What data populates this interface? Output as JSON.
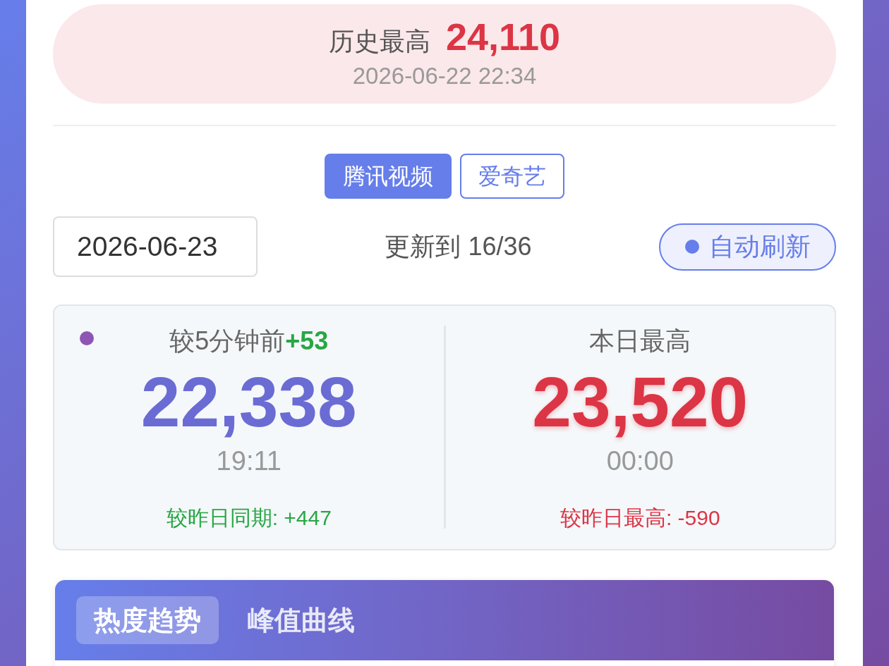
{
  "record": {
    "label": "历史最高",
    "value": "24,110",
    "time": "2026-06-22 22:34"
  },
  "platform_tabs": [
    {
      "label": "腾讯视频",
      "selected": true
    },
    {
      "label": "爱奇艺",
      "selected": false
    }
  ],
  "date_field": {
    "value": "2026-06-23"
  },
  "update_status": "更新到 16/36",
  "auto_refresh": {
    "label": "自动刷新",
    "on": true
  },
  "stats": [
    {
      "kind": "current",
      "live": true,
      "title": "较5分钟前",
      "delta": "+53",
      "value": "22,338",
      "time": "19:11",
      "comparison": "较昨日同期: +447",
      "rising": true
    },
    {
      "kind": "peak",
      "live": false,
      "title": "本日最高",
      "value": "23,520",
      "time": "00:00",
      "comparison": "较昨日最高: -590",
      "rising": false
    }
  ],
  "chart_tabs": [
    {
      "label": "热度趋势",
      "selected": true
    },
    {
      "label": "峰值曲线",
      "selected": false
    }
  ]
}
